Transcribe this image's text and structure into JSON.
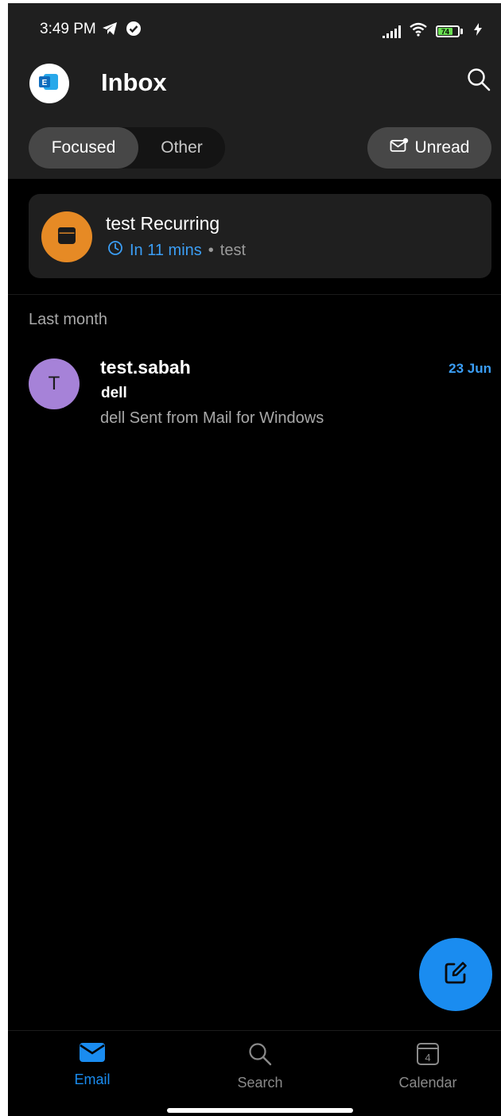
{
  "status_bar": {
    "time": "3:49 PM",
    "battery_level": "74",
    "icons": [
      "telegram-icon",
      "check-circle-icon",
      "signal-icon",
      "wifi-icon",
      "battery-icon",
      "charging-icon"
    ]
  },
  "header": {
    "title": "Inbox",
    "account_icon": "exchange-icon",
    "search_icon": "search-icon"
  },
  "filters": {
    "tabs": [
      {
        "label": "Focused",
        "selected": true
      },
      {
        "label": "Other",
        "selected": false
      }
    ],
    "unread_label": "Unread",
    "unread_icon": "mail-unread-icon"
  },
  "upcoming_event": {
    "title": "test Recurring",
    "time": "In 11 mins",
    "separator": "•",
    "location": "test",
    "icon": "calendar-icon"
  },
  "sections": [
    {
      "header": "Last month",
      "emails": [
        {
          "avatar_initial": "T",
          "sender": "test.sabah",
          "date": "23 Jun",
          "subject": "dell",
          "preview": "dell Sent from Mail for Windows"
        }
      ]
    }
  ],
  "fab": {
    "icon": "compose-icon"
  },
  "bottom_nav": [
    {
      "label": "Email",
      "icon": "mail-icon",
      "active": true
    },
    {
      "label": "Search",
      "icon": "search-icon",
      "active": false
    },
    {
      "label": "Calendar",
      "icon": "calendar-icon",
      "day": "4",
      "active": false
    }
  ],
  "colors": {
    "accent": "#1a8cf0",
    "event_icon_bg": "#e68a25",
    "avatar_bg": "#a682d8",
    "header_bg": "#1f1f1f",
    "background": "#000000"
  }
}
